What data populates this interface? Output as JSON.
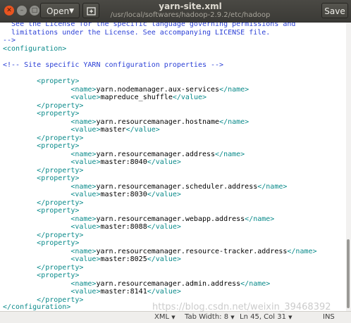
{
  "window": {
    "title": "yarn-site.xml",
    "path": "/usr/local/softwares/hadoop-2.9.2/etc/hadoop",
    "open_label": "Open",
    "save_label": "Save",
    "close_glyph": "✕"
  },
  "text": {
    "license_1": "  See the License for the specific language governing permissions and",
    "license_2": "  limitations under the License. See accompanying LICENSE file.",
    "comment_end": "-->",
    "config_open": "<configuration>",
    "site_comment": "<!-- Site specific YARN configuration properties -->",
    "prop_open": "<property>",
    "prop_close": "</property>",
    "name_open": "<name>",
    "name_close": "</name>",
    "value_open": "<value>",
    "value_close": "</value>",
    "config_close": "</configuration>"
  },
  "properties": [
    {
      "name": "yarn.nodemanager.aux-services",
      "value": "mapreduce_shuffle"
    },
    {
      "name": "yarn.resourcemanager.hostname",
      "value": "master"
    },
    {
      "name": "yarn.resourcemanager.address",
      "value": "master:8040"
    },
    {
      "name": "yarn.resourcemanager.scheduler.address",
      "value": "master:8030"
    },
    {
      "name": "yarn.resourcemanager.webapp.address",
      "value": "master:8088"
    },
    {
      "name": "yarn.resourcemanager.resource-tracker.address",
      "value": "master:8025"
    },
    {
      "name": "yarn.resourcemanager.admin.address",
      "value": "master:8141"
    }
  ],
  "status": {
    "language": "XML",
    "tab_width": "Tab Width: 8",
    "position": "Ln 45, Col 31",
    "mode": "INS"
  },
  "watermark": "https://blog.csdn.net/weixin_39468392",
  "colors": {
    "comment": "#2a3fd6",
    "tag": "#0a8a8a",
    "text": "#000000",
    "headerbar": "#3b3a36",
    "close_button": "#e95420"
  },
  "icons": [
    "close-icon",
    "minimize-icon",
    "maximize-icon",
    "chevron-down-icon",
    "new-tab-icon"
  ]
}
